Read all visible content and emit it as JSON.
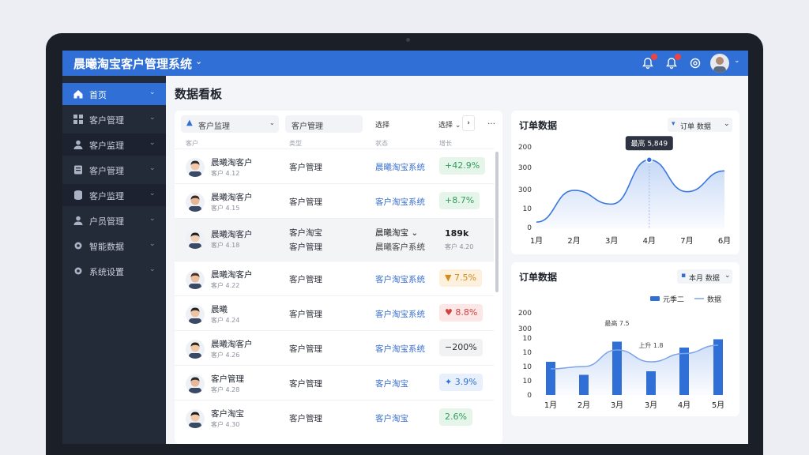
{
  "app": {
    "title": "晨曦淘宝客户管理系统",
    "title_caret": "⌄"
  },
  "topbar": {
    "avatar_caret": "⌄",
    "icons": [
      "bell-icon",
      "notification-icon",
      "settings-icon"
    ]
  },
  "sidebar": {
    "items": [
      {
        "label": "首页",
        "icon": "home-icon"
      },
      {
        "label": "客户管理",
        "icon": "grid-icon"
      },
      {
        "label": "客户监理",
        "icon": "user-icon"
      },
      {
        "label": "客户管理",
        "icon": "document-icon"
      },
      {
        "label": "客户监理",
        "icon": "database-icon"
      },
      {
        "label": "户员管理",
        "icon": "user-icon"
      },
      {
        "label": "智能数据",
        "icon": "gear-icon"
      },
      {
        "label": "系统设置",
        "icon": "gear-icon"
      }
    ],
    "caret": "⌄"
  },
  "page": {
    "title": "数据看板"
  },
  "table": {
    "filters": {
      "type_select": "客户监理",
      "search": "客户管理",
      "col_label": "选择",
      "dots": "…"
    },
    "headers": [
      "客户",
      "类型",
      "状态",
      "增长"
    ],
    "rows": [
      {
        "name": "晨曦淘客户",
        "sub": "客户 4.12",
        "type": "客户管理",
        "link": "晨曦淘宝系统",
        "pill": "+42.9%",
        "pill_kind": "green"
      },
      {
        "name": "晨曦淘客户",
        "sub": "客户 4.15",
        "type": "客户管理",
        "link": "客户淘宝系统",
        "pill": "+8.7%",
        "pill_kind": "green"
      },
      {
        "name": "晨曦淘客户",
        "sub": "客户 4.18",
        "type": "客户淘宝",
        "type2": "客户管理",
        "link": "晨曦淘宝",
        "link2": "晨曦客户系统",
        "pill": "189k",
        "pill2": "客户 4.20",
        "pill_kind": "plain"
      },
      {
        "name": "晨曦淘客户",
        "sub": "客户 4.22",
        "type": "客户管理",
        "link": "客户淘宝系统",
        "pill": "7.5%",
        "pill_kind": "orange"
      },
      {
        "name": "晨曦",
        "sub": "客户 4.24",
        "type": "客户管理",
        "link": "客户淘宝系统",
        "pill": "8.8%",
        "pill_kind": "red"
      },
      {
        "name": "晨曦淘客户",
        "sub": "客户 4.26",
        "type": "客户管理",
        "link": "客户淘宝系统",
        "pill": "−200%",
        "pill_kind": "gray"
      },
      {
        "name": "客户管理",
        "sub": "客户 4.28",
        "type": "客户管理",
        "link": "客户淘宝",
        "pill": "3.9%",
        "pill_kind": "blue"
      },
      {
        "name": "客户淘宝",
        "sub": "客户 4.30",
        "type": "客户管理",
        "link": "客户淘宝",
        "pill": "2.6%",
        "pill_kind": "green"
      }
    ]
  },
  "colors": {
    "accent": "#2f6fd6",
    "sidebar": "#232a38",
    "green": "#2e9e5b",
    "red": "#d14343",
    "orange": "#d48b1e"
  },
  "chart_data": [
    {
      "type": "area",
      "title": "订单数据",
      "control": "订单 数据",
      "categories": [
        "1月",
        "2月",
        "3月",
        "4月",
        "7月",
        "6月"
      ],
      "y_ticks": [
        "0",
        "10",
        "300",
        "300",
        "200"
      ],
      "values": [
        5,
        28,
        18,
        50,
        27,
        42
      ],
      "ylim": [
        0,
        65
      ],
      "annotation": {
        "text": "最高 5,849",
        "category": "4月"
      }
    },
    {
      "type": "bar",
      "title": "订单数据",
      "control": "本月 数据",
      "categories": [
        "1月",
        "2月",
        "3月",
        "3月",
        "4月",
        "5月"
      ],
      "y_ticks": [
        "0",
        "10",
        "10",
        "10",
        "10",
        "300",
        "200"
      ],
      "series": [
        {
          "name": "元季二",
          "values": [
            28,
            17,
            45,
            20,
            40,
            47
          ]
        },
        {
          "name": "数据",
          "values": [
            22,
            24,
            38,
            28,
            35,
            42
          ]
        }
      ],
      "ylim": [
        0,
        60
      ],
      "annotations": [
        "最高 7.5",
        "上升 1.8"
      ]
    }
  ]
}
